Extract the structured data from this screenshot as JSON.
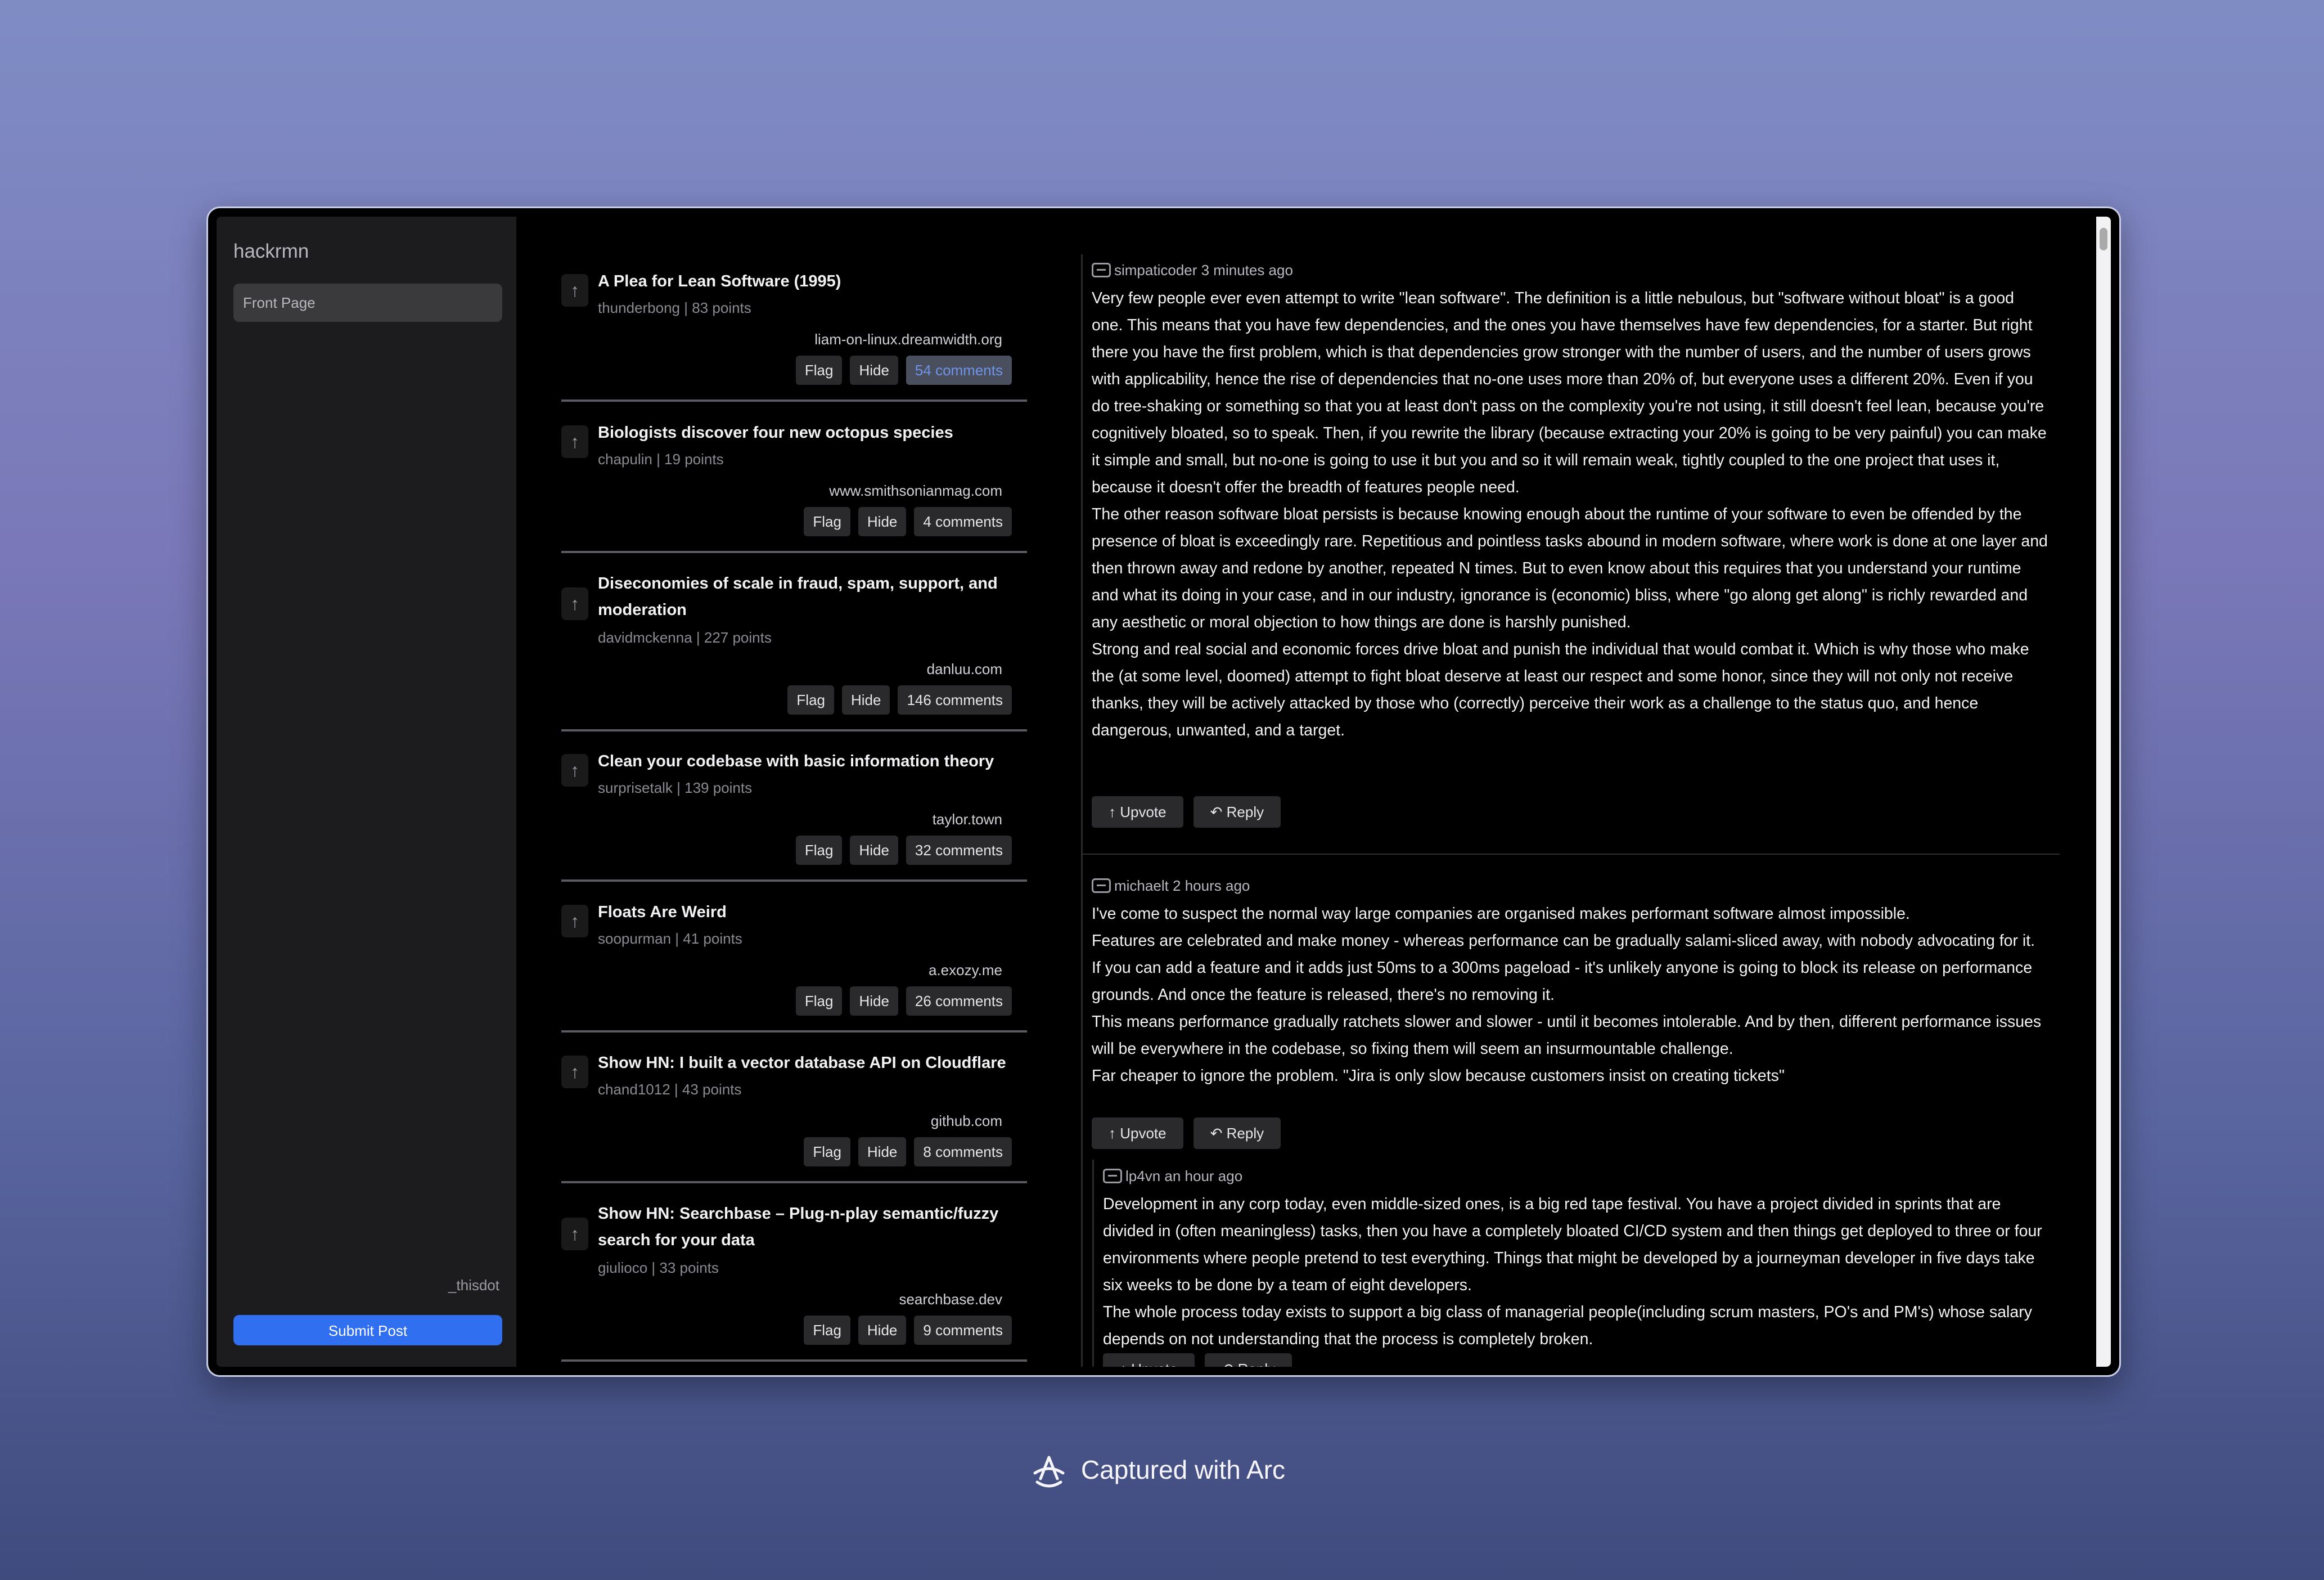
{
  "app": {
    "brand": "hackrmn",
    "username": "_thisdot"
  },
  "sidebar": {
    "nav": [
      {
        "label": "Front Page"
      }
    ],
    "submit_label": "Submit Post"
  },
  "stories": [
    {
      "title": "A Plea for Lean Software (1995)",
      "meta": "thunderbong | 83 points",
      "domain": "liam-on-linux.dreamwidth.org",
      "flag": "Flag",
      "hide": "Hide",
      "comments": "54 comments",
      "active": true
    },
    {
      "title": "Biologists discover four new octopus species",
      "meta": "chapulin | 19 points",
      "domain": "www.smithsonianmag.com",
      "flag": "Flag",
      "hide": "Hide",
      "comments": "4 comments"
    },
    {
      "title": "Diseconomies of scale in fraud, spam, support, and moderation",
      "meta": "davidmckenna | 227 points",
      "domain": "danluu.com",
      "flag": "Flag",
      "hide": "Hide",
      "comments": "146 comments"
    },
    {
      "title": "Clean your codebase with basic information theory",
      "meta": "surprisetalk | 139 points",
      "domain": "taylor.town",
      "flag": "Flag",
      "hide": "Hide",
      "comments": "32 comments"
    },
    {
      "title": "Floats Are Weird",
      "meta": "soopurman | 41 points",
      "domain": "a.exozy.me",
      "flag": "Flag",
      "hide": "Hide",
      "comments": "26 comments"
    },
    {
      "title": "Show HN: I built a vector database API on Cloudflare",
      "meta": "chand1012 | 43 points",
      "domain": "github.com",
      "flag": "Flag",
      "hide": "Hide",
      "comments": "8 comments"
    },
    {
      "title": "Show HN: Searchbase – Plug-n-play semantic/fuzzy search for your data",
      "meta": "giulioco | 33 points",
      "domain": "searchbase.dev",
      "flag": "Flag",
      "hide": "Hide",
      "comments": "9 comments"
    }
  ],
  "comments": [
    {
      "author_line": "simpaticoder 3 minutes ago",
      "paragraphs": [
        "Very few people ever even attempt to write \"lean software\". The definition is a little nebulous, but \"software without bloat\" is a good one. This means that you have few dependencies, and the ones you have themselves have few dependencies, for a starter. But right there you have the first problem, which is that dependencies grow stronger with the number of users, and the number of users grows with applicability, hence the rise of dependencies that no-one uses more than 20% of, but everyone uses a different 20%. Even if you do tree-shaking or something so that you at least don't pass on the complexity you're not using, it still doesn't feel lean, because you're cognitively bloated, so to speak. Then, if you rewrite the library (because extracting your 20% is going to be very painful) you can make it simple and small, but no-one is going to use it but you and so it will remain weak, tightly coupled to the one project that uses it, because it doesn't offer the breadth of features people need.",
        "The other reason software bloat persists is because knowing enough about the runtime of your software to even be offended by the presence of bloat is exceedingly rare. Repetitious and pointless tasks abound in modern software, where work is done at one layer and then thrown away and redone by another, repeated N times. But to even know about this requires that you understand your runtime and what its doing in your case, and in our industry, ignorance is (economic) bliss, where \"go along get along\" is richly rewarded and any aesthetic or moral objection to how things are done is harshly punished.",
        "Strong and real social and economic forces drive bloat and punish the individual that would combat it. Which is why those who make the (at some level, doomed) attempt to fight bloat deserve at least our respect and some honor, since they will not only not receive thanks, they will be actively attacked by those who (correctly) perceive their work as a challenge to the status quo, and hence dangerous, unwanted, and a target."
      ],
      "upvote": "Upvote",
      "reply": "Reply"
    },
    {
      "author_line": "michaelt 2 hours ago",
      "paragraphs": [
        "I've come to suspect the normal way large companies are organised makes performant software almost impossible.",
        "Features are celebrated and make money - whereas performance can be gradually salami-sliced away, with nobody advocating for it.",
        "If you can add a feature and it adds just 50ms to a 300ms pageload - it's unlikely anyone is going to block its release on performance grounds. And once the feature is released, there's no removing it.",
        "This means performance gradually ratchets slower and slower - until it becomes intolerable. And by then, different performance issues will be everywhere in the codebase, so fixing them will seem an insurmountable challenge.",
        "Far cheaper to ignore the problem. \"Jira is only slow because customers insist on creating tickets\""
      ],
      "upvote": "Upvote",
      "reply": "Reply"
    },
    {
      "author_line": "lp4vn an hour ago",
      "paragraphs": [
        "Development in any corp today, even middle-sized ones, is a big red tape festival. You have a project divided in sprints that are divided in (often meaningless) tasks, then you have a completely bloated CI/CD system and then things get deployed to three or four environments where people pretend to test everything. Things that might be developed by a journeyman developer in five days take six weeks to be done by a team of eight developers.",
        "The whole process today exists to support a big class of managerial people(including scrum masters, PO's and PM's) whose salary depends on not understanding that the process is completely broken."
      ],
      "upvote": "Upvote",
      "reply": "Reply"
    }
  ],
  "footer": {
    "caption": "Captured with Arc"
  },
  "colors": {
    "accent": "#2f6ff0",
    "active_link": "#6f93e8",
    "background": "#000000",
    "sidebar": "#1c1c1e"
  }
}
